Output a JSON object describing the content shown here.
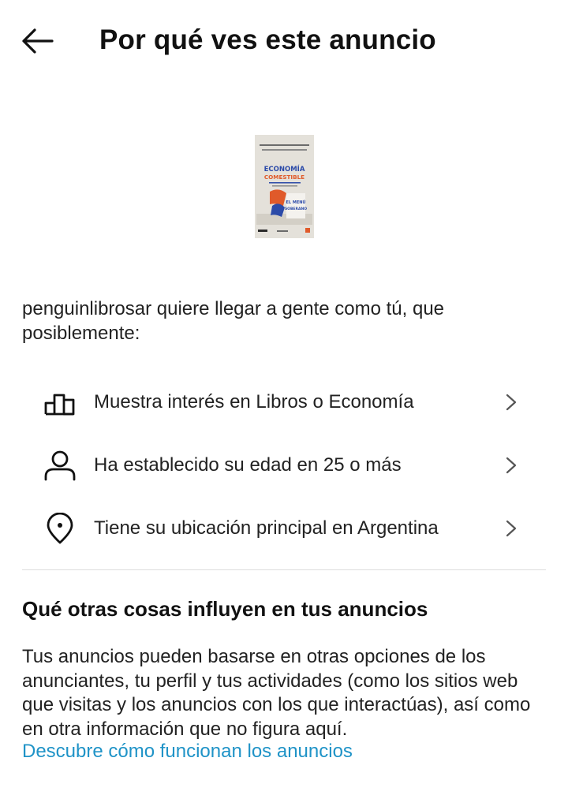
{
  "header": {
    "title": "Por qué ves este anuncio",
    "back_icon": "arrow-left-icon"
  },
  "ad_preview": {
    "cover_top_text": "CLAUDIO ZUCHOVICKI • MARTÍN KALBERMATTER",
    "cover_title_line1": "ECONOMÍA",
    "cover_title_line2": "COMESTIBLE",
    "cover_sub_text": "EL MENÚ",
    "cover_sub_text2": "SOBERANO",
    "colors": {
      "background": "#e4e1da",
      "title": "#2b4aa8",
      "accent": "#e05a2a",
      "dark": "#2a2a2a"
    }
  },
  "intro": {
    "text": "penguinlibrosar quiere llegar a gente como tú, que posiblemente:"
  },
  "reasons": [
    {
      "label": "Muestra interés en Libros o Economía",
      "icon": "bar-chart-icon"
    },
    {
      "label": "Ha establecido su edad en 25 o más",
      "icon": "person-icon"
    },
    {
      "label": "Tiene su ubicación principal en Argentina",
      "icon": "location-pin-icon"
    }
  ],
  "more_section": {
    "title": "Qué otras cosas influyen en tus anuncios",
    "body": "Tus anuncios pueden basarse en otras opciones de los anunciantes, tu perfil y tus actividades (como los sitios web que visitas y los anuncios con los que interactúas), así como en otra información que no figura aquí.",
    "link": "Descubre cómo funcionan los anuncios"
  },
  "colors": {
    "link": "#1f93c7",
    "divider": "#dcdcdc",
    "text": "#222222"
  }
}
